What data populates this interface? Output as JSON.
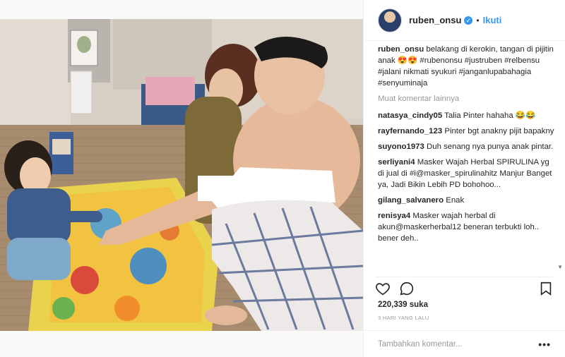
{
  "post": {
    "username": "ruben_onsu",
    "separator": "•",
    "follow_label": "Ikuti",
    "likes": "220,339 suka",
    "time": "3 HARI YANG LALU",
    "add_comment_placeholder": "Tambahkan komentar...",
    "more_options": "•••",
    "load_more": "Muat komentar lainnya"
  },
  "caption": {
    "user": "ruben_onsu",
    "text": "belakang di kerokin, tangan di pijitin anak 😍😍 #rubenonsu #justruben #relbensu #jalani nikmati syukuri #janganlupabahagia #senyuminaja"
  },
  "comments": [
    {
      "user": "natasya_cindy05",
      "text": "Talia Pinter hahaha 😂😂"
    },
    {
      "user": "rayfernando_123",
      "text": "Pinter bgt anakny pijit bapakny"
    },
    {
      "user": "suyono1973",
      "text": "Duh senang nya punya anak pintar."
    },
    {
      "user": "serliyani4",
      "text": "Masker Wajah Herbal SPIRULINA yg di jual di #i@masker_spirulinahitz Manjur Banget ya, Jadi Bikin Lebih PD bohohoo..."
    },
    {
      "user": "gilang_salvanero",
      "text": "Enak"
    },
    {
      "user": "renisya4",
      "text": "Masker wajah herbal di akun@maskerherbal12 beneran terbukti loh.. bener deh.."
    }
  ],
  "colors": {
    "accent": "#3897f0",
    "text": "#262626",
    "muted": "#999999"
  },
  "icons": {
    "like": "heart-icon",
    "comment": "comment-bubble-icon",
    "save": "bookmark-icon",
    "verified": "verified-badge-icon"
  }
}
